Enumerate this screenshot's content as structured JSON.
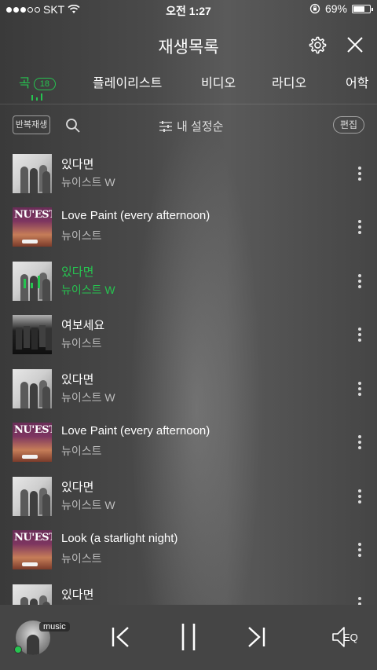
{
  "status_bar": {
    "carrier": "SKT",
    "time": "오전 1:27",
    "battery": "69%",
    "battery_level": 0.69
  },
  "header": {
    "title": "재생목록",
    "settings_icon": "gear-icon",
    "close_icon": "close-icon"
  },
  "tabs": [
    {
      "label": "곡",
      "badge": "18",
      "active": true
    },
    {
      "label": "플레이리스트"
    },
    {
      "label": "비디오"
    },
    {
      "label": "라디오"
    },
    {
      "label": "어학"
    }
  ],
  "toolbar": {
    "repeat_label": "반복재생",
    "sort_label": "내 설정순",
    "edit_label": "편집"
  },
  "songs": [
    {
      "title": "있다면",
      "artist": "뉴이스트 W"
    },
    {
      "title": "Love Paint (every afternoon)",
      "artist": "뉴이스트",
      "art_text": "NU'EST"
    },
    {
      "title": "있다면",
      "artist": "뉴이스트 W",
      "playing": true
    },
    {
      "title": "여보세요",
      "artist": "뉴이스트"
    },
    {
      "title": "있다면",
      "artist": "뉴이스트 W"
    },
    {
      "title": "Love Paint (every afternoon)",
      "artist": "뉴이스트",
      "art_text": "NU'EST"
    },
    {
      "title": "있다면",
      "artist": "뉴이스트 W"
    },
    {
      "title": "Look (a starlight night)",
      "artist": "뉴이스트",
      "art_text": "NU'EST"
    },
    {
      "title": "있다면",
      "artist": ""
    }
  ],
  "player": {
    "source_label": "music",
    "eq_label": "EQ"
  },
  "colors": {
    "accent": "#26c450"
  }
}
